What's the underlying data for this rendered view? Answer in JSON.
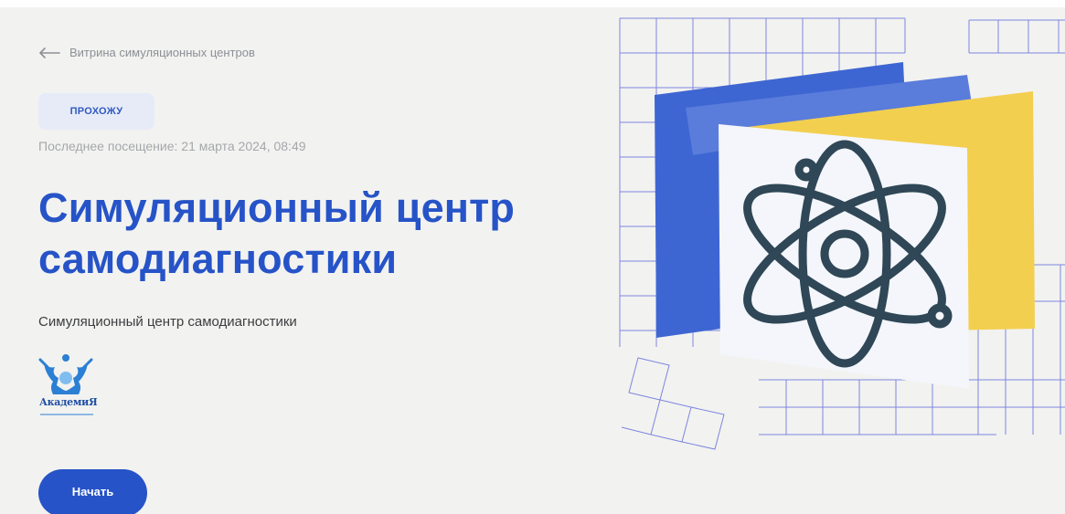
{
  "header": {
    "back_link_label": "Витрина симуляционных центров"
  },
  "status": {
    "badge": "ПРОХОЖУ",
    "last_visit": "Последнее посещение: 21 марта 2024, 08:49"
  },
  "main": {
    "title_line1": "Симуляционный центр",
    "title_line2": "самодиагностики",
    "subtitle": "Симуляционный центр самодиагностики",
    "start_button_label": "Начать"
  },
  "logo": {
    "text": "АкадемиЯ"
  },
  "icons": {
    "back": "arrow-left-icon",
    "hero": "atom-icon"
  },
  "colors": {
    "primary": "#2653c7",
    "badge_bg": "#e6ebf7",
    "page_bg": "#f2f2f0",
    "folder_yellow": "#f3cf4f",
    "grid_line": "#7d86e0",
    "atom_stroke": "#2f4756"
  }
}
